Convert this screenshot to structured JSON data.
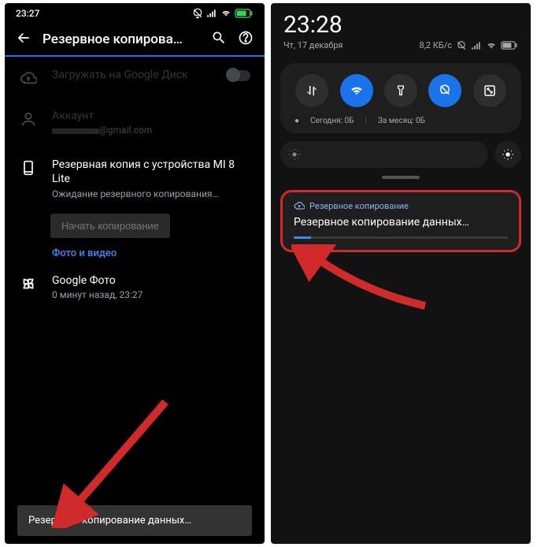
{
  "left": {
    "status_time": "23:27",
    "header_title": "Резервное копирова…",
    "upload_drive": "Загружать на Google Диск",
    "account_label": "Аккаунт",
    "account_email": "@gmail.com",
    "device_title": "Резервная копия с устройства MI 8 Lite",
    "device_sub": "Ожидание резервного копирования…",
    "start_btn": "Начать копирование",
    "section": "Фото и видео",
    "gphotos_title": "Google Фото",
    "gphotos_sub": "0 минут назад, 23:27",
    "toast": "Резервное копирование данных…"
  },
  "right": {
    "time": "23:28",
    "date": "Чт, 17 декабря",
    "net_speed": "8,2 КБ/с",
    "usage_dot": "●",
    "usage_today": "Сегодня: 0Б",
    "usage_month": "За месяц: 0Б",
    "notif_app": "Резервное копирование",
    "notif_title": "Резервное копирование данных…"
  }
}
